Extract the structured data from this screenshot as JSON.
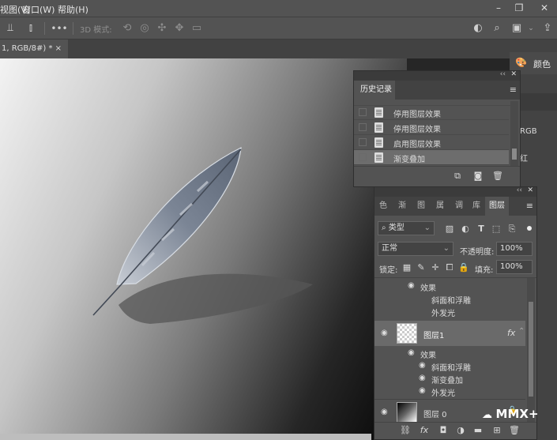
{
  "menu": [
    "视图(V)",
    "窗口(W)",
    "帮助(H)"
  ],
  "window_controls": [
    "–",
    "❐",
    "✕"
  ],
  "options_bar": {
    "mode_3d_label": "3D 模式:",
    "more": "•••"
  },
  "doc_tab": {
    "title": "1, RGB/8#) *",
    "close": "×"
  },
  "right_dock": {
    "color_label": "颜色",
    "rgb_label": "RGB",
    "red_label": "红"
  },
  "history_panel": {
    "title": "历史记录",
    "items": [
      {
        "label": "停用图层效果",
        "current": false
      },
      {
        "label": "停用图层效果",
        "current": false
      },
      {
        "label": "启用图层效果",
        "current": false
      },
      {
        "label": "渐变叠加",
        "current": true
      }
    ]
  },
  "layers_panel": {
    "tabs": [
      "色",
      "渐",
      "图",
      "属",
      "调",
      "库",
      "图层"
    ],
    "filter_label": "类型",
    "blend_mode": "正常",
    "opacity_label": "不透明度:",
    "opacity_value": "100%",
    "lock_label": "锁定:",
    "fill_label": "填充:",
    "fill_value": "100%",
    "effects_group_top": {
      "label": "效果",
      "items": [
        "斜面和浮雕",
        "外发光"
      ]
    },
    "layers": [
      {
        "name": "图层1",
        "fx": "fx",
        "effects_label": "效果",
        "effects": [
          "斜面和浮雕",
          "渐变叠加",
          "外发光"
        ]
      },
      {
        "name": "图层 0"
      }
    ],
    "bottom_icons": [
      "link-icon",
      "fx",
      "mask-icon",
      "adjustment-icon",
      "folder-icon",
      "new-layer-icon",
      "trash-icon"
    ],
    "bottom_fx": "fx"
  },
  "watermark": "MMX+",
  "colors": {
    "panel_bg": "#535353",
    "dark_bg": "#262626",
    "selected_row": "#6d6d6d",
    "accent_text": "#f0f0f0"
  }
}
